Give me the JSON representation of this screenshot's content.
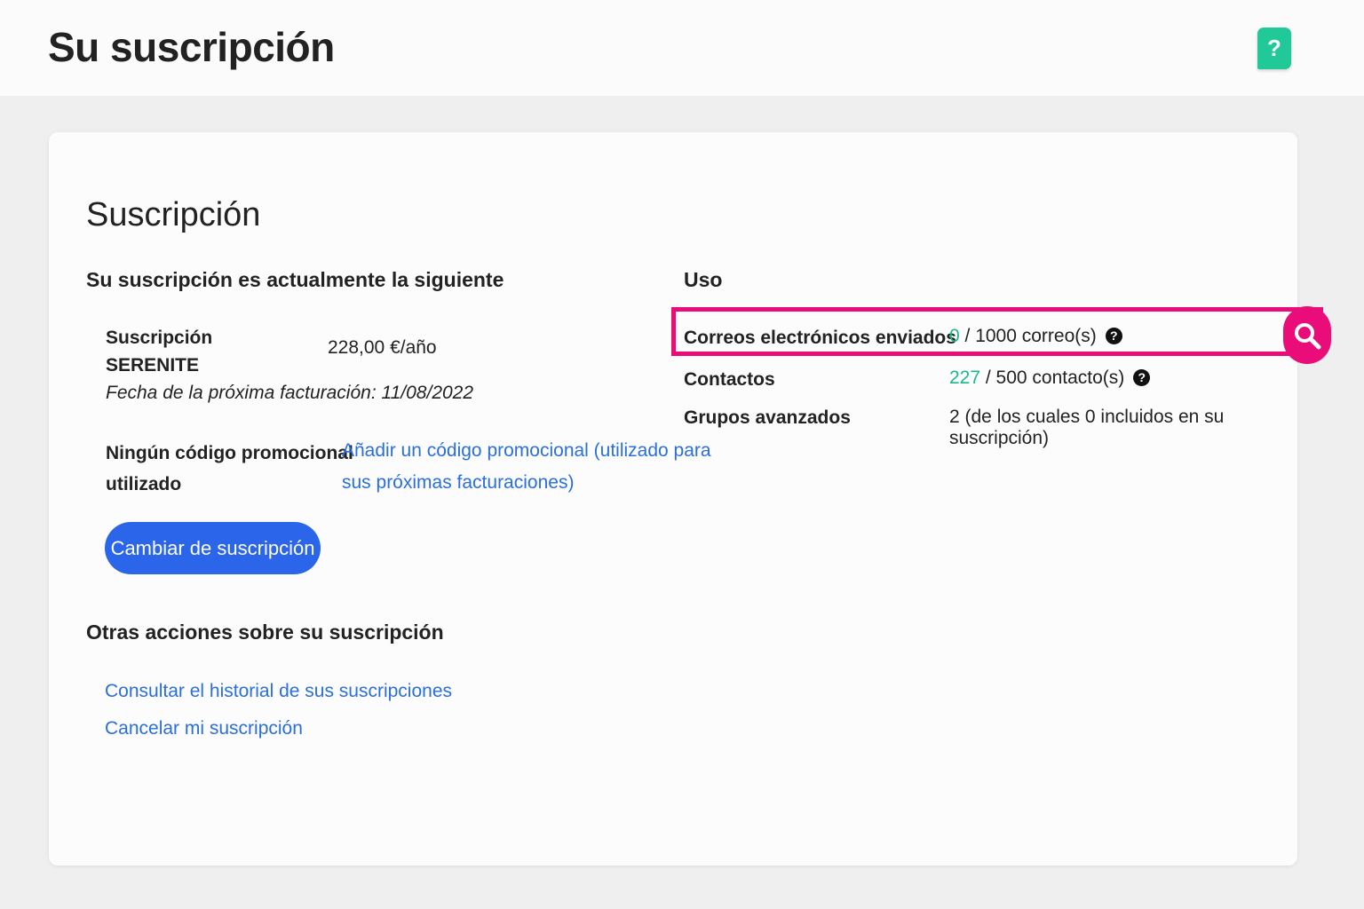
{
  "header": {
    "title": "Su suscripción",
    "help_label": "?"
  },
  "card": {
    "title": "Suscripción",
    "current": {
      "heading": "Su suscripción es actualmente la siguiente",
      "plan_label_1": "Suscripción",
      "plan_label_2": "SERENITE",
      "price": "228,00 €/año",
      "next_billing": "Fecha de la próxima facturación: 11/08/2022",
      "promo_label_1": "Ningún código promocional",
      "promo_label_2": "utilizado",
      "promo_link_1": "Añadir un código promocional (utilizado para",
      "promo_link_2": "sus próximas facturaciones)",
      "change_button": "Cambiar de suscripción"
    },
    "other_actions": {
      "heading": "Otras acciones sobre su suscripción",
      "links": [
        "Consultar el historial de sus suscripciones",
        "Cancelar mi suscripción"
      ]
    },
    "usage": {
      "heading": "Uso",
      "rows": [
        {
          "label": "Correos electrónicos enviados",
          "used": "0",
          "rest": " / 1000 correo(s)"
        },
        {
          "label": "Contactos",
          "used": "227",
          "rest": " / 500 contacto(s)"
        },
        {
          "label": "Grupos avanzados",
          "used": "",
          "rest": "2 (de los cuales 0 incluidos en su suscripción)"
        }
      ],
      "help_glyph": "?"
    }
  },
  "colors": {
    "accent_green": "#1bb98a",
    "button_blue": "#2b66ea",
    "link_blue": "#2a6fdb",
    "highlight_pink": "#ea0c78",
    "help_teal": "#20c997"
  },
  "icons": {
    "help": "question-icon",
    "highlight": "magnifier-icon"
  }
}
